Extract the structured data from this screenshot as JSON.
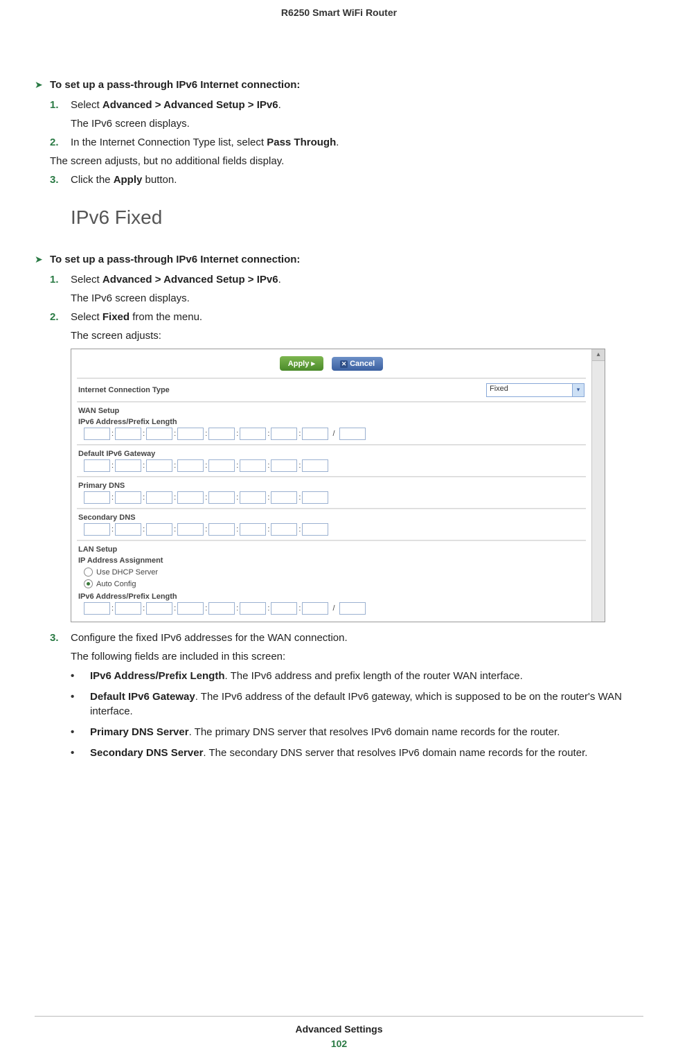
{
  "header": {
    "title": "R6250 Smart WiFi Router"
  },
  "section1": {
    "heading": "To set up a pass-through IPv6 Internet connection:",
    "step1": {
      "num": "1.",
      "pre": "Select ",
      "bold": "Advanced > Advanced Setup > IPv6",
      "post": ".",
      "sub": "The IPv6 screen displays."
    },
    "step2": {
      "num": "2.",
      "pre": "In the Internet Connection Type list, select ",
      "bold": "Pass Through",
      "post": "."
    },
    "note": "The screen adjusts, but no additional fields display.",
    "step3": {
      "num": "3.",
      "pre": "Click the ",
      "bold": "Apply",
      "post": " button."
    }
  },
  "h2": "IPv6 Fixed",
  "section2": {
    "heading": "To set up a pass-through IPv6 Internet connection:",
    "step1": {
      "num": "1.",
      "pre": "Select ",
      "bold": "Advanced > Advanced Setup > IPv6",
      "post": ".",
      "sub": "The IPv6 screen displays."
    },
    "step2": {
      "num": "2.",
      "pre": "Select ",
      "bold": "Fixed",
      "post": " from the menu.",
      "sub": "The screen adjusts:"
    },
    "step3": {
      "num": "3.",
      "text": "Configure the fixed IPv6 addresses for the WAN connection.",
      "sub": "The following fields are included in this screen:"
    }
  },
  "shot": {
    "apply": "Apply ▸",
    "cancel": "Cancel",
    "conn_type_label": "Internet Connection Type",
    "conn_type_value": "Fixed",
    "wan_setup": "WAN Setup",
    "ipv6_addr": "IPv6 Address/Prefix Length",
    "def_gw": "Default IPv6 Gateway",
    "primary_dns": "Primary DNS",
    "secondary_dns": "Secondary DNS",
    "lan_setup": "LAN Setup",
    "ip_assign": "IP Address Assignment",
    "dhcp": "Use DHCP Server",
    "auto": "Auto Config",
    "ipv6_addr2": "IPv6 Address/Prefix Length",
    "slash": "/"
  },
  "bullets": {
    "b1": {
      "label": "IPv6 Address/Prefix Length",
      "text": ". The IPv6 address and prefix length of the router WAN interface."
    },
    "b2": {
      "label": "Default IPv6 Gateway",
      "text": ". The IPv6 address of the default IPv6 gateway, which is supposed to be on the router's WAN interface."
    },
    "b3": {
      "label": "Primary DNS Server",
      "text": ". The primary DNS server that resolves IPv6 domain name records for the router."
    },
    "b4": {
      "label": "Secondary DNS Server",
      "text": ". The secondary DNS server that resolves IPv6 domain name records for the router."
    }
  },
  "footer": {
    "text": "Advanced Settings",
    "page": "102"
  }
}
